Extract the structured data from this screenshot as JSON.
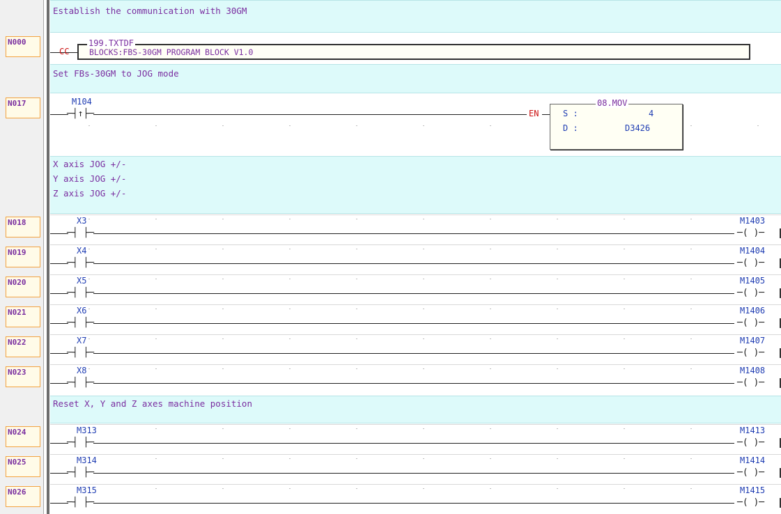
{
  "comments": [
    {
      "lines": [
        "Establish the communication with 30GM"
      ]
    },
    {
      "lines": [
        "Set FBs-30GM to JOG mode"
      ]
    },
    {
      "lines": [
        "X axis JOG +/-",
        "Y axis JOG +/-",
        "Z axis JOG +/-"
      ]
    },
    {
      "lines": [
        "Reset X, Y and Z axes machine position"
      ]
    }
  ],
  "network_n000": {
    "number": "N000",
    "power_flow": "CC",
    "function": "199.TXTDF",
    "text": "BLOCKS:FBS-30GM PROGRAM BLOCK V1.0"
  },
  "network_n017": {
    "number": "N017",
    "contact": "M104",
    "contact_symbol": "─┤↑├─",
    "enable": "EN",
    "function": "08.MOV",
    "operand_s_label": "S :",
    "operand_s_value": "4",
    "operand_d_label": "D :",
    "operand_d_value": "D3426"
  },
  "rungs": [
    {
      "number": "N018",
      "contact": "X3",
      "coil": "M1403"
    },
    {
      "number": "N019",
      "contact": "X4",
      "coil": "M1404"
    },
    {
      "number": "N020",
      "contact": "X5",
      "coil": "M1405"
    },
    {
      "number": "N021",
      "contact": "X6",
      "coil": "M1406"
    },
    {
      "number": "N022",
      "contact": "X7",
      "coil": "M1407"
    },
    {
      "number": "N023",
      "contact": "X8",
      "coil": "M1408"
    },
    {
      "number": "N024",
      "contact": "M313",
      "coil": "M1413"
    },
    {
      "number": "N025",
      "contact": "M314",
      "coil": "M1414"
    },
    {
      "number": "N026",
      "contact": "M315",
      "coil": "M1415"
    }
  ],
  "symbols": {
    "contact_no": "─┤ ├─",
    "coil": "─( )─"
  }
}
